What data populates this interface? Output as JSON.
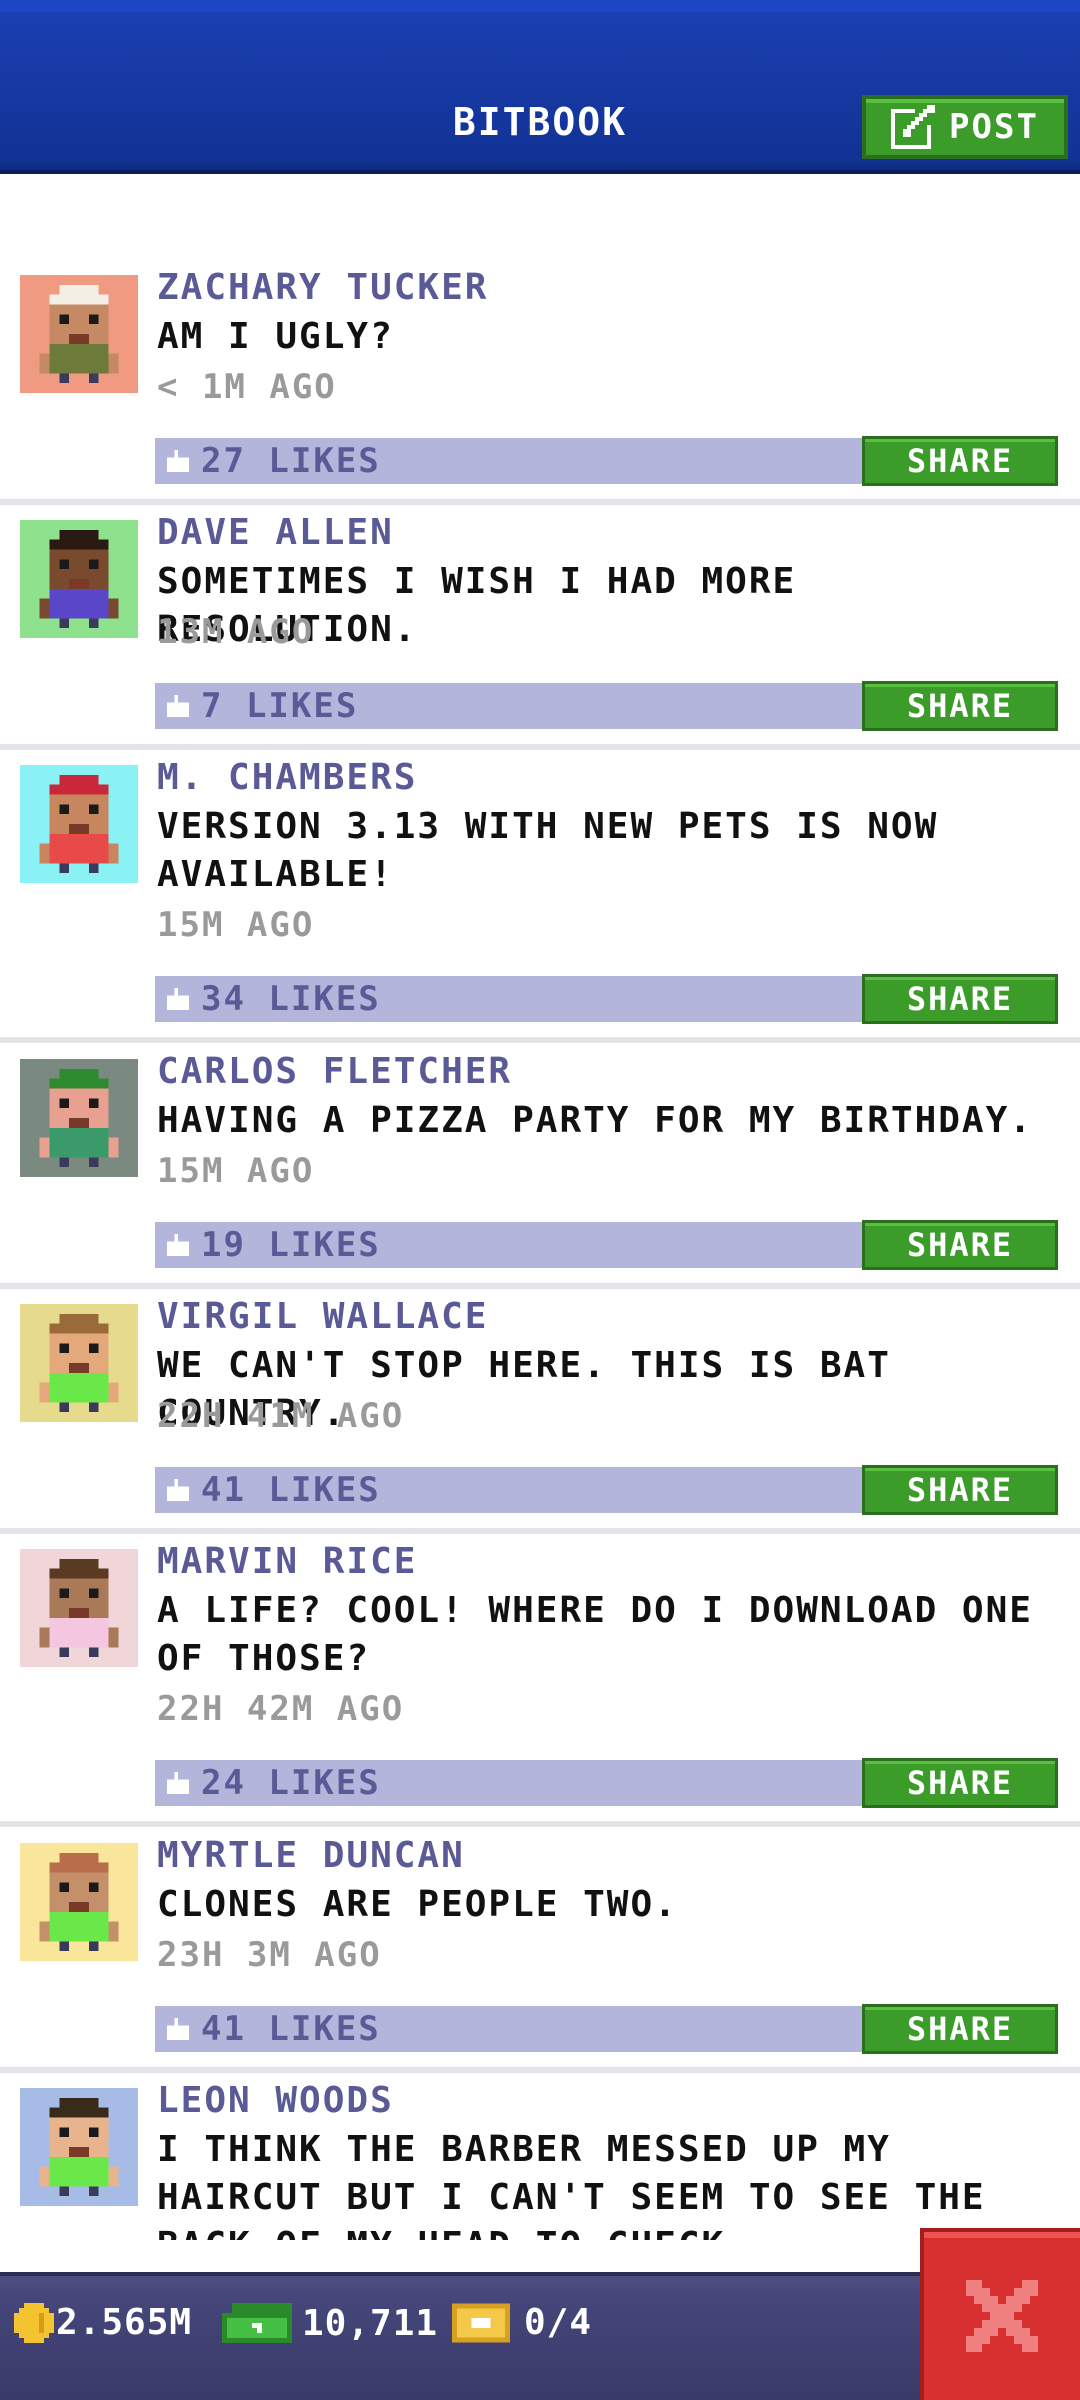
{
  "header": {
    "title": "BITBOOK",
    "post_label": "POST"
  },
  "share_label": "SHARE",
  "colors": {
    "header_blue": "#123294",
    "share_green": "#3c9c2a",
    "likes_bar": "#b3b5da",
    "name_purple": "#5a5a96",
    "close_red": "#d83030"
  },
  "posts": [
    {
      "name": "ZACHARY TUCKER",
      "text": "AM I UGLY?",
      "time": "< 1M AGO",
      "likes": "27 LIKES",
      "avatar_bg": "#f09a82",
      "skin": "#c58a64",
      "hair": "#f4f0e6",
      "shirt": "#6c7a3a"
    },
    {
      "name": "DAVE ALLEN",
      "text": "SOMETIMES I WISH I HAD MORE RESOLUTION.",
      "time": "13M AGO",
      "likes": "7 LIKES",
      "avatar_bg": "#8ee28e",
      "skin": "#7a4a2e",
      "hair": "#2a1a12",
      "shirt": "#5a46c8"
    },
    {
      "name": "M. CHAMBERS",
      "text": "VERSION 3.13 WITH NEW PETS IS NOW AVAILABLE!",
      "time": "15M AGO",
      "likes": "34 LIKES",
      "avatar_bg": "#8af2f4",
      "skin": "#c8865e",
      "hair": "#c8283a",
      "shirt": "#e84a4a"
    },
    {
      "name": "CARLOS FLETCHER",
      "text": "HAVING A PIZZA PARTY FOR MY BIRTHDAY.",
      "time": "15M AGO",
      "likes": "19 LIKES",
      "avatar_bg": "#7a8a80",
      "skin": "#e8a090",
      "hair": "#2e8a2e",
      "shirt": "#3a9a6a"
    },
    {
      "name": "VIRGIL WALLACE",
      "text": "WE CAN'T STOP HERE. THIS IS BAT COUNTRY.",
      "time": "22H 41M AGO",
      "likes": "41 LIKES",
      "avatar_bg": "#e6da8c",
      "skin": "#e4a87a",
      "hair": "#9a6a3a",
      "shirt": "#6ae84a"
    },
    {
      "name": "MARVIN RICE",
      "text": "A LIFE? COOL! WHERE DO I DOWNLOAD ONE OF THOSE?",
      "time": "22H 42M AGO",
      "likes": "24 LIKES",
      "avatar_bg": "#f0d6d8",
      "skin": "#a87a58",
      "hair": "#5a3a22",
      "shirt": "#f4c6e0"
    },
    {
      "name": "MYRTLE DUNCAN",
      "text": "CLONES ARE PEOPLE TWO.",
      "time": "23H 3M AGO",
      "likes": "41 LIKES",
      "avatar_bg": "#fae69a",
      "skin": "#c4906a",
      "hair": "#b86e4a",
      "shirt": "#6ae84a"
    },
    {
      "name": "LEON WOODS",
      "text": "I THINK THE BARBER MESSED UP MY HAIRCUT BUT I CAN'T SEEM TO SEE THE BACK OF MY HEAD TO CHECK.",
      "time": "",
      "likes": "",
      "avatar_bg": "#a6bce6",
      "skin": "#e8b48e",
      "hair": "#3a2a1a",
      "shirt": "#6ae84a"
    }
  ],
  "bottom_bar": {
    "coins": "2.565M",
    "bucks": "10,711",
    "tickets": "0/4"
  }
}
